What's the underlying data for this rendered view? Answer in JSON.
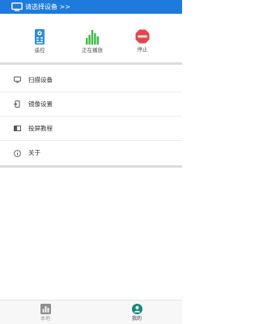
{
  "header": {
    "title": "请选择设备 >>",
    "icon": "tv-icon",
    "background_color": "#1e7bde"
  },
  "controls": [
    {
      "label": "遥控",
      "icon": "remote-icon",
      "color": "#2a8fd8"
    },
    {
      "label": "正在播放",
      "icon": "playing-bars-icon",
      "color": "#3cb946"
    },
    {
      "label": "停止",
      "icon": "stop-icon",
      "color": "#e0474c"
    }
  ],
  "menu": [
    {
      "label": "扫描设备",
      "icon": "monitor-icon"
    },
    {
      "label": "镜像设置",
      "icon": "mirror-icon"
    },
    {
      "label": "投屏教程",
      "icon": "book-icon"
    },
    {
      "label": "关于",
      "icon": "info-icon"
    }
  ],
  "bottom_nav": {
    "tabs": [
      {
        "label": "本地",
        "icon": "chart-icon",
        "active": false
      },
      {
        "label": "我的",
        "icon": "user-icon",
        "active": true
      }
    ],
    "active_color": "#16897a",
    "inactive_color": "#8f8f8f"
  }
}
